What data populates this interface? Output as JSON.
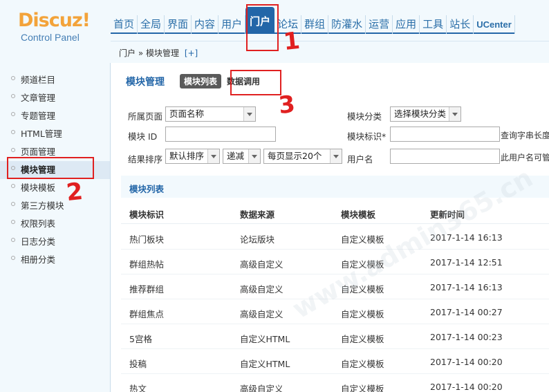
{
  "logo": {
    "title": "Discuz!",
    "subtitle": "Control Panel"
  },
  "nav": [
    {
      "label": "首页"
    },
    {
      "label": "全局"
    },
    {
      "label": "界面"
    },
    {
      "label": "内容"
    },
    {
      "label": "用户"
    },
    {
      "label": "门户",
      "active": true
    },
    {
      "label": "论坛"
    },
    {
      "label": "群组"
    },
    {
      "label": "防灌水"
    },
    {
      "label": "运营"
    },
    {
      "label": "应用"
    },
    {
      "label": "工具"
    },
    {
      "label": "站长"
    },
    {
      "label": "UCenter"
    }
  ],
  "breadcrumb": {
    "text": "门户 » 模块管理",
    "add": "[+]"
  },
  "sidebar": {
    "items": [
      {
        "label": "频道栏目"
      },
      {
        "label": "文章管理"
      },
      {
        "label": "专题管理"
      },
      {
        "label": "HTML管理"
      },
      {
        "label": "页面管理"
      },
      {
        "label": "模块管理",
        "active": true
      },
      {
        "label": "模块模板"
      },
      {
        "label": "第三方模块"
      },
      {
        "label": "权限列表"
      },
      {
        "label": "日志分类"
      },
      {
        "label": "相册分类"
      }
    ]
  },
  "main": {
    "title": "模块管理",
    "tabs": [
      {
        "label": "模块列表"
      },
      {
        "label": "数据调用"
      }
    ],
    "filters": {
      "page_label": "所属页面",
      "page_value": "页面名称",
      "category_label": "模块分类",
      "category_value": "选择模块分类",
      "id_label": "模块 ID",
      "ident_label": "模块标识*",
      "ident_hint": "查询字串长度",
      "sort_label": "结果排序",
      "sort_value": "默认排序",
      "order_value": "递减",
      "perpage_value": "每页显示20个",
      "user_label": "用户名",
      "user_hint": "此用户名可管"
    },
    "section_title": "模块列表",
    "table": {
      "headers": [
        "模块标识",
        "数据来源",
        "模块模板",
        "更新时间"
      ],
      "rows": [
        [
          "热门板块",
          "论坛版块",
          "自定义模板",
          "2017-1-14 16:13"
        ],
        [
          "群组热帖",
          "高级自定义",
          "自定义模板",
          "2017-1-14 12:51"
        ],
        [
          "推荐群组",
          "高级自定义",
          "自定义模板",
          "2017-1-14 16:13"
        ],
        [
          "群组焦点",
          "高级自定义",
          "自定义模板",
          "2017-1-14 00:27"
        ],
        [
          "5宫格",
          "自定义HTML",
          "自定义模板",
          "2017-1-14 00:23"
        ],
        [
          "投稿",
          "自定义HTML",
          "自定义模板",
          "2017-1-14 00:20"
        ],
        [
          "热文",
          "高级自定义",
          "自定义模板",
          "2017-1-14 00:20"
        ]
      ]
    }
  },
  "annotations": [
    "1",
    "2",
    "3"
  ],
  "watermark": "www.admin365.cn",
  "colors": {
    "accent": "#2366a8",
    "logo": "#f3a33a",
    "annotation": "#e02020"
  }
}
